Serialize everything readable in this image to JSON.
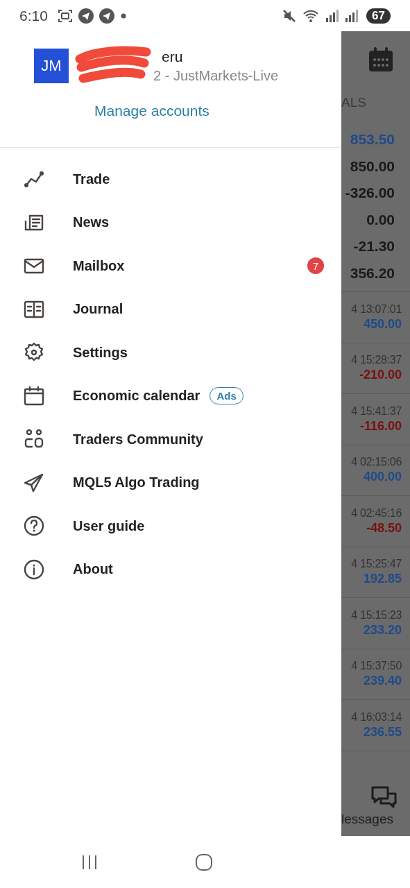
{
  "status_bar": {
    "time": "6:10",
    "battery": "67"
  },
  "drawer": {
    "account": {
      "avatar": "JM",
      "name": "eru",
      "server": "2 - JustMarkets-Live",
      "manage": "Manage accounts"
    },
    "items": [
      {
        "label": "Trade"
      },
      {
        "label": "News"
      },
      {
        "label": "Mailbox",
        "badge": "7"
      },
      {
        "label": "Journal"
      },
      {
        "label": "Settings"
      },
      {
        "label": "Economic calendar",
        "tag": "Ads"
      },
      {
        "label": "Traders Community"
      },
      {
        "label": "MQL5 Algo Trading"
      },
      {
        "label": "User guide"
      },
      {
        "label": "About"
      }
    ]
  },
  "background": {
    "header": "ALS",
    "summary": [
      {
        "value": "853.50",
        "color": "#1f4a8a"
      },
      {
        "value": "850.00",
        "color": "#1a1a1a"
      },
      {
        "value": "-326.00",
        "color": "#1a1a1a"
      },
      {
        "value": "0.00",
        "color": "#1a1a1a"
      },
      {
        "value": "-21.30",
        "color": "#1a1a1a"
      },
      {
        "value": "356.20",
        "color": "#1a1a1a"
      }
    ],
    "deals": [
      {
        "time": "4 13:07:01",
        "amount": "450.00",
        "color": "#1f4a8a"
      },
      {
        "time": "4 15:28:37",
        "amount": "-210.00",
        "color": "#7a1010"
      },
      {
        "time": "4 15:41:37",
        "amount": "-116.00",
        "color": "#7a1010"
      },
      {
        "time": "4 02:15:06",
        "amount": "400.00",
        "color": "#1f4a8a"
      },
      {
        "time": "4 02:45:16",
        "amount": "-48.50",
        "color": "#7a1010"
      },
      {
        "time": "4 15:25:47",
        "amount": "192.85",
        "color": "#1f4a8a"
      },
      {
        "time": "4 15:15:23",
        "amount": "233.20",
        "color": "#1f4a8a"
      },
      {
        "time": "4 15:37:50",
        "amount": "239.40",
        "color": "#1f4a8a"
      },
      {
        "time": "4 16:03:14",
        "amount": "236.55",
        "color": "#1f4a8a"
      }
    ],
    "tab": "lessages"
  }
}
